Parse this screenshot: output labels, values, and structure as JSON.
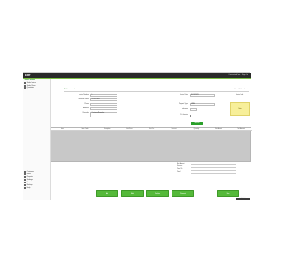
{
  "window": {
    "logo_text": "ERP",
    "user_text": "Connected User · Sign Out"
  },
  "sidebar": {
    "title": "Sales Module",
    "items_top": [
      {
        "label": "Sales Invoice"
      },
      {
        "label": "Sales Return"
      },
      {
        "label": "Quotations"
      }
    ],
    "items_bottom": [
      {
        "label": "Customers"
      },
      {
        "label": "Items"
      },
      {
        "label": "Reports"
      },
      {
        "label": "Settings"
      },
      {
        "label": "Users"
      },
      {
        "label": "Backup"
      },
      {
        "label": "Help"
      }
    ]
  },
  "page": {
    "title": "Sales Invoice",
    "breadcrumb": "Home / Sales Invoice"
  },
  "form": {
    "invoice_no_label": "Invoice Number",
    "invoice_no_value": "1",
    "customer_label": "Customer Name",
    "customer_value": "CUSTOMER",
    "phone_label": "Phone",
    "phone_value": "",
    "address_label": "Address",
    "address_value": "",
    "notes_label": "Remarks",
    "notes_value": "Customer Remarks",
    "date_label": "Invoice Date",
    "date_value": "01/01/2023",
    "payment_label": "Payment Type",
    "payment_value": "CASH",
    "salesman_label": "Salesman",
    "salesman_value": "",
    "check_label": "Print Invoice",
    "search_button": "Search"
  },
  "note": {
    "label": "Invoice Info",
    "value": "Note"
  },
  "grid": {
    "columns": [
      "Item",
      "Item Code",
      "Description",
      "Unit Price",
      "Unit Cost",
      "Discount",
      "Quantity",
      "Net Amount",
      "Total Amount"
    ]
  },
  "totals": [
    {
      "label": "Net Amount",
      "value": ""
    },
    {
      "label": "Discount",
      "value": ""
    },
    {
      "label": "Total Tax",
      "value": ""
    },
    {
      "label": "Total",
      "value": ""
    }
  ],
  "actions": [
    {
      "label": "Add"
    },
    {
      "label": "Edit"
    },
    {
      "label": "Delete"
    },
    {
      "label": "Payment"
    },
    {
      "label": "Save"
    }
  ],
  "footer": {
    "badge": "Ver. 1.0"
  },
  "colors": {
    "accent_green": "#55b93a",
    "topbar": "#2a2a2a",
    "note_yellow": "#f7ef9a"
  }
}
